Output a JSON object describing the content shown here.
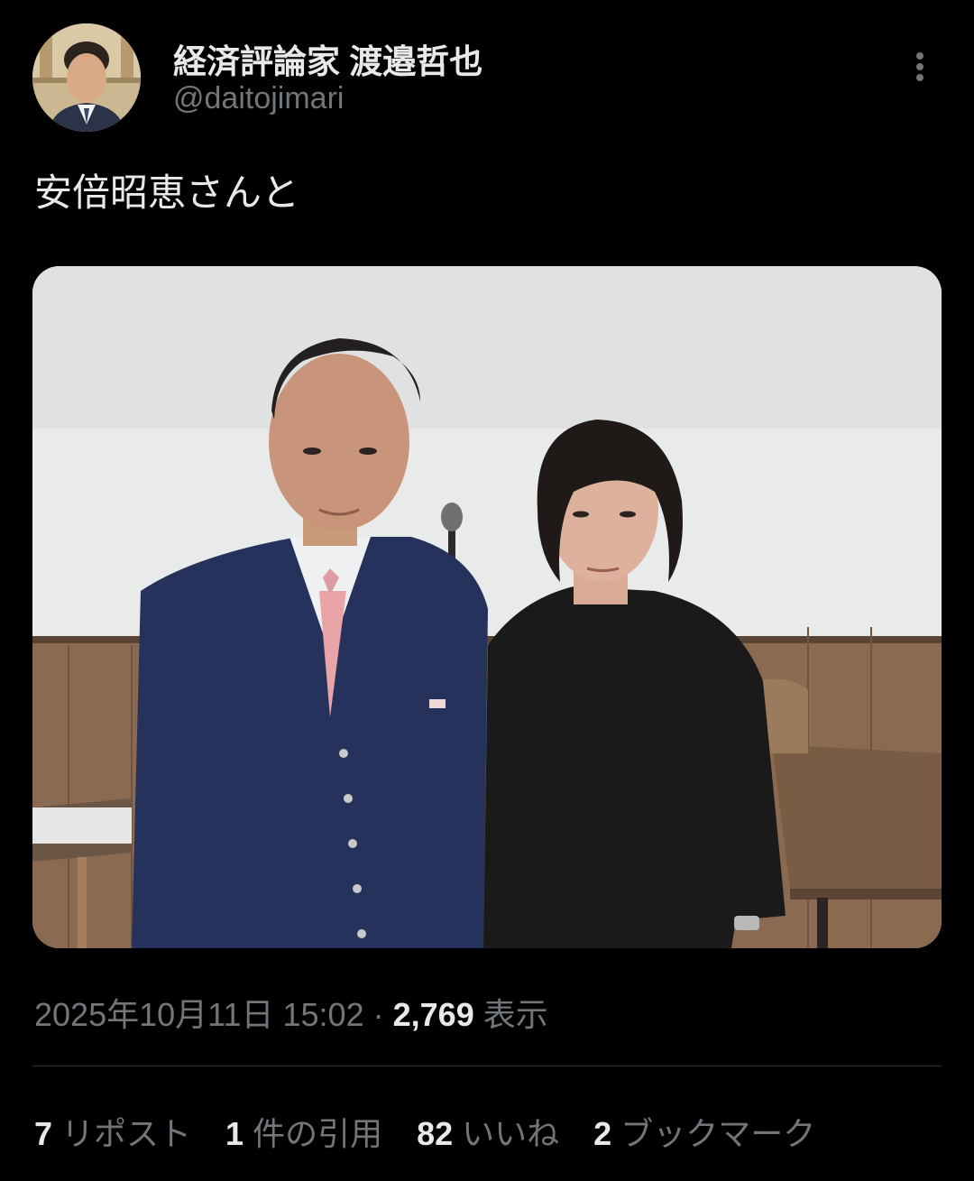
{
  "author": {
    "display_name": "経済評論家 渡邉哲也",
    "handle": "@daitojimari"
  },
  "tweet": {
    "text": "安倍昭恵さんと",
    "date": "2025年10月11日 15:02",
    "separator": "·",
    "views_count": "2,769",
    "views_label": "表示"
  },
  "stats": [
    {
      "count": "7",
      "label": "リポスト"
    },
    {
      "count": "1",
      "label": "件の引用"
    },
    {
      "count": "82",
      "label": "いいね"
    },
    {
      "count": "2",
      "label": "ブックマーク"
    }
  ],
  "colors": {
    "background": "#000000",
    "primary_text": "#e7e9ea",
    "secondary_text": "#71767b",
    "divider": "#2f3336"
  },
  "icons": {
    "more": "more-vertical-icon"
  }
}
